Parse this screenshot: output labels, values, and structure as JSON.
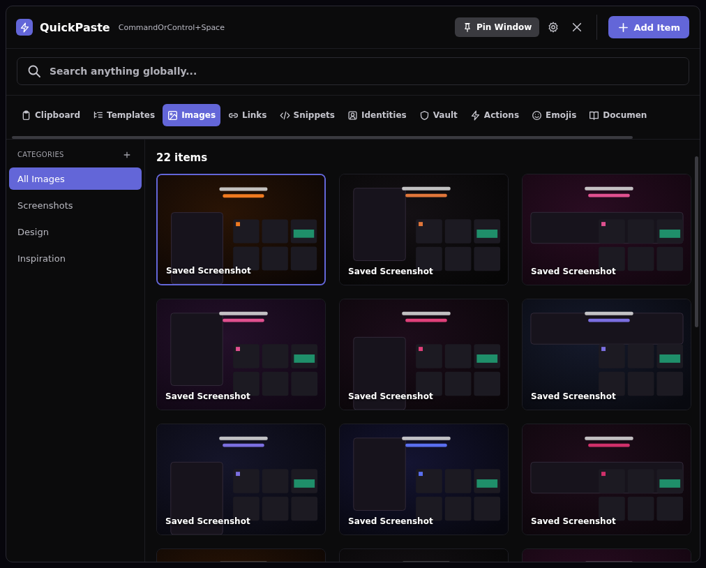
{
  "app": {
    "title": "QuickPaste",
    "shortcut": "CommandOrControl+Space"
  },
  "header_buttons": {
    "pin": "Pin Window",
    "add": "Add Item"
  },
  "search": {
    "placeholder": "Search anything globally..."
  },
  "tabs": [
    {
      "label": "Clipboard",
      "selected": false
    },
    {
      "label": "Templates",
      "selected": false
    },
    {
      "label": "Images",
      "selected": true
    },
    {
      "label": "Links",
      "selected": false
    },
    {
      "label": "Snippets",
      "selected": false
    },
    {
      "label": "Identities",
      "selected": false
    },
    {
      "label": "Vault",
      "selected": false
    },
    {
      "label": "Actions",
      "selected": false
    },
    {
      "label": "Emojis",
      "selected": false
    },
    {
      "label": "Documen",
      "selected": false
    }
  ],
  "sidebar": {
    "heading": "CATEGORIES",
    "items": [
      {
        "label": "All Images",
        "selected": true
      },
      {
        "label": "Screenshots",
        "selected": false
      },
      {
        "label": "Design",
        "selected": false
      },
      {
        "label": "Inspiration",
        "selected": false
      }
    ]
  },
  "content": {
    "count": "22 items",
    "cards": [
      {
        "kind": "picture",
        "caption": "Saved Screenshot",
        "selected": true
      },
      {
        "kind": "picture",
        "caption": "Saved Screenshot",
        "selected": false
      },
      {
        "kind": "picture",
        "caption": "Saved Screenshot",
        "selected": false
      },
      {
        "kind": "picture",
        "caption": "Saved Screenshot",
        "selected": false
      },
      {
        "kind": "picture",
        "caption": "Saved Screenshot",
        "selected": false
      },
      {
        "kind": "picture",
        "caption": "Saved Screenshot",
        "selected": false
      },
      {
        "kind": "picture",
        "caption": "Saved Screenshot",
        "selected": false
      },
      {
        "kind": "picture",
        "caption": "Saved Screenshot",
        "selected": false
      },
      {
        "kind": "picture",
        "caption": "Saved Screenshot",
        "selected": false
      },
      {
        "kind": "picture",
        "selected": false
      },
      {
        "kind": "picture",
        "selected": false
      },
      {
        "kind": "picture",
        "selected": false
      }
    ]
  }
}
